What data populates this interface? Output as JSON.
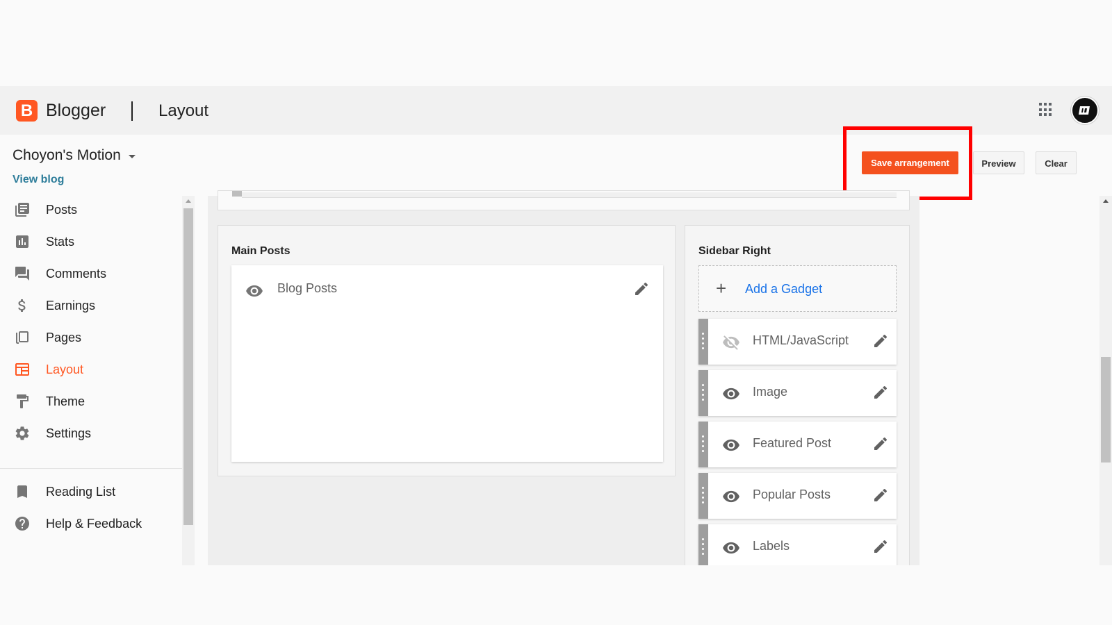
{
  "header": {
    "logo_letter": "B",
    "brand": "Blogger",
    "page_title": "Layout"
  },
  "blog": {
    "name": "Choyon's Motion",
    "view_blog": "View blog"
  },
  "actions": {
    "save": "Save arrangement",
    "preview": "Preview",
    "clear": "Clear"
  },
  "sidebar": {
    "items": [
      {
        "label": "Posts",
        "icon": "posts-icon"
      },
      {
        "label": "Stats",
        "icon": "stats-icon"
      },
      {
        "label": "Comments",
        "icon": "comments-icon"
      },
      {
        "label": "Earnings",
        "icon": "dollar-icon"
      },
      {
        "label": "Pages",
        "icon": "pages-icon"
      },
      {
        "label": "Layout",
        "icon": "layout-icon",
        "active": true
      },
      {
        "label": "Theme",
        "icon": "paint-roller-icon"
      },
      {
        "label": "Settings",
        "icon": "gear-icon"
      }
    ],
    "secondary": [
      {
        "label": "Reading List",
        "icon": "bookmark-icon"
      },
      {
        "label": "Help & Feedback",
        "icon": "help-icon"
      }
    ]
  },
  "main_posts": {
    "title": "Main Posts",
    "gadget": "Blog Posts"
  },
  "sidebar_right": {
    "title": "Sidebar Right",
    "add_gadget": "Add a Gadget",
    "gadgets": [
      {
        "name": "HTML/JavaScript",
        "visible": false
      },
      {
        "name": "Image",
        "visible": true
      },
      {
        "name": "Featured Post",
        "visible": true
      },
      {
        "name": "Popular Posts",
        "visible": true
      },
      {
        "name": "Labels",
        "visible": true
      }
    ]
  },
  "colors": {
    "accent": "#ff5722",
    "highlight": "#ff0000",
    "link": "#1a73e8"
  }
}
